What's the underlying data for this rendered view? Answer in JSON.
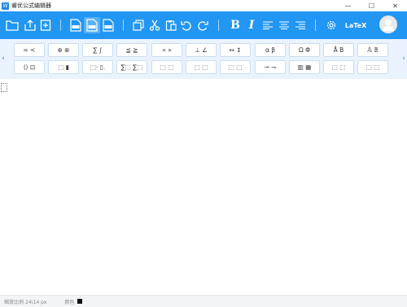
{
  "window": {
    "title": "睿优公式编辑器",
    "logo_text": "W",
    "minimize": "—",
    "maximize": "☐",
    "close": "✕"
  },
  "toolbar": {
    "bold_label": "B",
    "italic_label": "I",
    "latex_label": "LaTeX",
    "accent_color": "#2196f3"
  },
  "palette": {
    "row1": [
      "= <",
      "⊕ ⊗",
      "∑ ∫",
      "≦ ≧",
      "« »",
      "⊥ ∠",
      "↔ ↕",
      "α β",
      "Ω Φ",
      "Å B",
      "𝔸 𝔹"
    ],
    "row2": [
      "⟨⟩ ⊡",
      "⬚ ▮",
      "⬚· ▯.",
      "∑⬚ ∑⬚",
      "⬚ ⬚",
      "⬚ ⬚",
      "⬚ ⬚",
      "⇀ ⇁",
      "▥ ▦",
      "⬚ ⬚",
      "⬚ ⬚"
    ],
    "left_arrow": "‹",
    "right_arrow": "›"
  },
  "status": {
    "zoom_text": "缩放比例 24\\14 px",
    "color_label": "颜色",
    "color_value": "#111111"
  }
}
